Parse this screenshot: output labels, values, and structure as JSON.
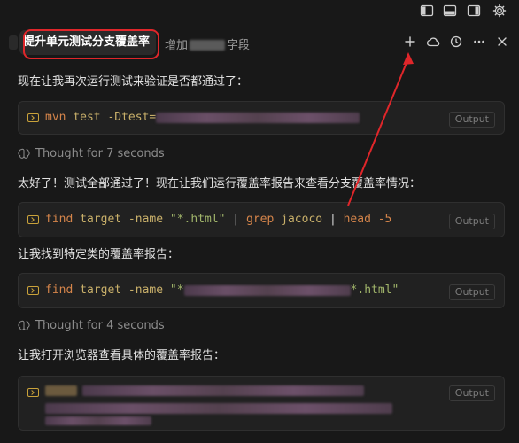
{
  "window_controls": {
    "icons": [
      "sidebar-left-icon",
      "panel-bottom-icon",
      "sidebar-right-icon",
      "settings-gear-icon"
    ]
  },
  "tabs": {
    "active": "提升单元测试分支覆盖率",
    "second_prefix": "增加",
    "second_suffix": "字段"
  },
  "header_icons": [
    "plus-icon",
    "cloud-icon",
    "history-icon",
    "more-icon",
    "close-icon"
  ],
  "messages": {
    "m1": "现在让我再次运行测试来验证是否都通过了：",
    "m2": "太好了！测试全部通过了！现在让我们运行覆盖率报告来查看分支覆盖率情况：",
    "m3": "让我找到特定类的覆盖率报告：",
    "m4": "让我打开浏览器查看具体的覆盖率报告："
  },
  "thoughts": {
    "t1": "Thought for 7 seconds",
    "t2": "Thought for 4 seconds"
  },
  "code_blocks": {
    "c1": {
      "cmd": "mvn",
      "arg": "test -Dtest="
    },
    "c2": {
      "cmd": "find",
      "arg": "target -name",
      "str": "\"*.html\"",
      "pipe1": "|",
      "cmd2": "grep",
      "arg2": "jacoco",
      "pipe2": "|",
      "cmd3": "head",
      "num": "-5"
    },
    "c3": {
      "cmd": "find",
      "arg": "target -name",
      "str_start": "\"*",
      "str_end": "*.html\""
    },
    "output_label": "Output"
  },
  "colors": {
    "background": "#181818",
    "code_bg": "#212121",
    "annotation_red": "#e0262a",
    "command": "#d4844a",
    "string": "#a0b46a"
  }
}
